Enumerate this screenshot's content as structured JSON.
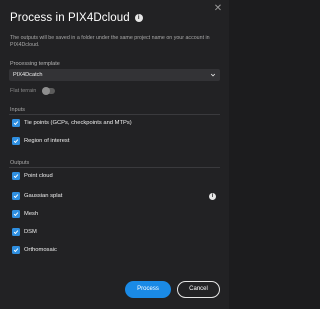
{
  "dialog": {
    "title": "Process in PIX4Dcloud",
    "description": "The outputs will be saved in a folder under the same project name on your account in PIX4Dcloud.",
    "close_icon": "close-icon",
    "info_icon": "info-icon"
  },
  "template": {
    "label": "Processing template",
    "value": "PIX4Dcatch"
  },
  "flat_terrain": {
    "label": "Flat terrain",
    "enabled": false
  },
  "inputs": {
    "label": "Inputs",
    "items": [
      {
        "label": "Tie points (GCPs, checkpoints and MTPs)",
        "checked": true
      },
      {
        "label": "Region of interest",
        "checked": true
      }
    ]
  },
  "outputs": {
    "label": "Outputs",
    "items": [
      {
        "label": "Point cloud",
        "checked": true
      },
      {
        "label": "Gaussian splat",
        "checked": true,
        "has_info": true
      },
      {
        "label": "Mesh",
        "checked": true
      },
      {
        "label": "DSM",
        "checked": true
      },
      {
        "label": "Orthomosaic",
        "checked": true
      }
    ]
  },
  "actions": {
    "process_label": "Process",
    "cancel_label": "Cancel"
  },
  "colors": {
    "accent": "#1a8ae6",
    "background": "#222224"
  }
}
